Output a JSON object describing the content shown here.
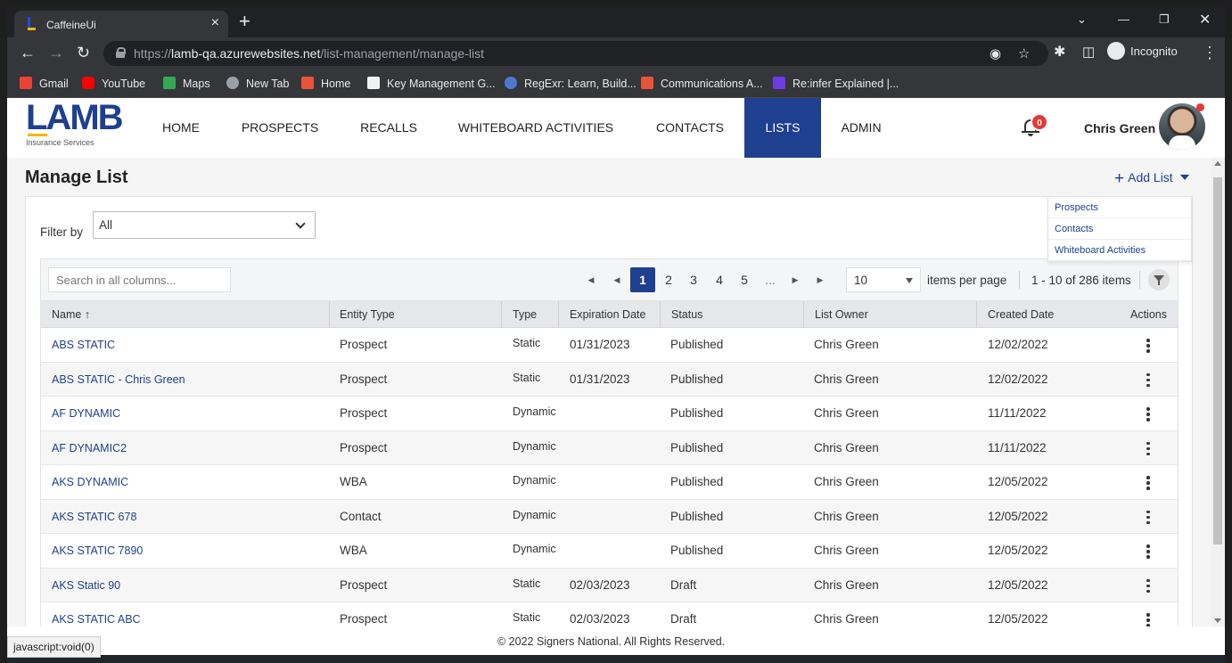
{
  "browser": {
    "tab_title": "CaffeineUi",
    "tab_close": "×",
    "new_tab": "+",
    "url_scheme": "https://",
    "url_host": "lamb-qa.azurewebsites.net",
    "url_path": "/list-management/manage-list",
    "profile": "Incognito",
    "bookmarks": [
      "Gmail",
      "YouTube",
      "Maps",
      "New Tab",
      "Home",
      "Key Management G...",
      "RegExr: Learn, Build...",
      "Communications A...",
      "Re:infer Explained |..."
    ]
  },
  "app": {
    "logo_text": "LAMB",
    "logo_tagline": "Insurance Services",
    "nav": [
      "HOME",
      "PROSPECTS",
      "RECALLS",
      "WHITEBOARD ACTIVITIES",
      "CONTACTS",
      "LISTS",
      "ADMIN"
    ],
    "active_nav": "LISTS",
    "notification_count": "0",
    "user_name": "Chris Green",
    "brand_color": "#1f3f8f"
  },
  "page": {
    "title": "Manage List",
    "add_list_label": "Add List",
    "add_list_menu": [
      "Prospects",
      "Contacts",
      "Whiteboard Activities"
    ],
    "filter_label": "Filter by",
    "filter_value": "All"
  },
  "grid": {
    "search_placeholder": "Search in all columns...",
    "pages": [
      "1",
      "2",
      "3",
      "4",
      "5",
      "..."
    ],
    "current_page": "1",
    "page_size": "10",
    "items_per_page_label": "items per page",
    "range_text": "1 - 10 of 286 items",
    "columns": [
      "Name ↑",
      "Entity Type",
      "Type",
      "Expiration Date",
      "Status",
      "List Owner",
      "Created Date",
      "Actions"
    ],
    "rows": [
      {
        "name": "ABS STATIC",
        "entity": "Prospect",
        "type": "Static",
        "expiration": "01/31/2023",
        "status": "Published",
        "owner": "Chris Green",
        "created": "12/02/2022"
      },
      {
        "name": "ABS STATIC - Chris Green",
        "entity": "Prospect",
        "type": "Static",
        "expiration": "01/31/2023",
        "status": "Published",
        "owner": "Chris Green",
        "created": "12/02/2022"
      },
      {
        "name": "AF DYNAMIC",
        "entity": "Prospect",
        "type": "Dynamic",
        "expiration": "",
        "status": "Published",
        "owner": "Chris Green",
        "created": "11/11/2022"
      },
      {
        "name": "AF DYNAMIC2",
        "entity": "Prospect",
        "type": "Dynamic",
        "expiration": "",
        "status": "Published",
        "owner": "Chris Green",
        "created": "11/11/2022"
      },
      {
        "name": "AKS DYNAMIC",
        "entity": "WBA",
        "type": "Dynamic",
        "expiration": "",
        "status": "Published",
        "owner": "Chris Green",
        "created": "12/05/2022"
      },
      {
        "name": "AKS STATIC 678",
        "entity": "Contact",
        "type": "Dynamic",
        "expiration": "",
        "status": "Published",
        "owner": "Chris Green",
        "created": "12/05/2022"
      },
      {
        "name": "AKS STATIC 7890",
        "entity": "WBA",
        "type": "Dynamic",
        "expiration": "",
        "status": "Published",
        "owner": "Chris Green",
        "created": "12/05/2022"
      },
      {
        "name": "AKS Static 90",
        "entity": "Prospect",
        "type": "Static",
        "expiration": "02/03/2023",
        "status": "Draft",
        "owner": "Chris Green",
        "created": "12/05/2022"
      },
      {
        "name": "AKS STATIC ABC",
        "entity": "Prospect",
        "type": "Static",
        "expiration": "02/03/2023",
        "status": "Draft",
        "owner": "Chris Green",
        "created": "12/05/2022"
      }
    ]
  },
  "footer": {
    "copyright": "© 2022 Signers National. All Rights Reserved.",
    "status_url": "javascript:void(0)"
  }
}
